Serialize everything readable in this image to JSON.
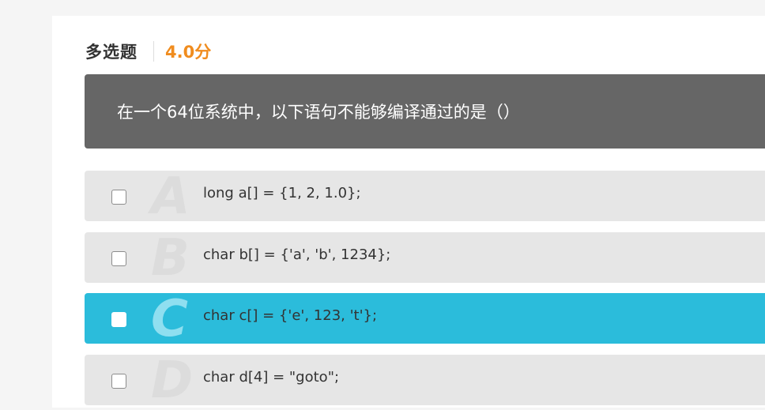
{
  "header": {
    "question_type": "多选题",
    "score": "4.0分"
  },
  "question": {
    "text": "在一个64位系统中，以下语句不能够编译通过的是（）"
  },
  "options": [
    {
      "letter": "A",
      "text": "long a[] = {1, 2, 1.0};",
      "selected": false
    },
    {
      "letter": "B",
      "text": "char b[] = {'a', 'b', 1234};",
      "selected": false
    },
    {
      "letter": "C",
      "text": "char c[] = {'e', 123, 't'};",
      "selected": true
    },
    {
      "letter": "D",
      "text": "char d[4] = \"goto\";",
      "selected": false
    }
  ],
  "colors": {
    "score": "#f08c1e",
    "question_bg": "#666666",
    "option_bg": "#e6e6e6",
    "selected_bg": "#2bbcdb"
  }
}
